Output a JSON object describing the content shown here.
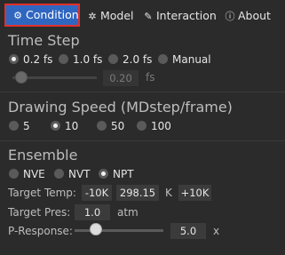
{
  "tabs": [
    {
      "label": "Condition",
      "icon": "gear-icon"
    },
    {
      "label": "Model",
      "icon": "atom-icon"
    },
    {
      "label": "Interaction",
      "icon": "wand-icon"
    },
    {
      "label": "About",
      "icon": "info-icon"
    }
  ],
  "time_step": {
    "heading": "Time Step",
    "options": [
      "0.2 fs",
      "1.0 fs",
      "2.0 fs",
      "Manual"
    ],
    "selected": "0.2 fs",
    "manual_value": "0.20",
    "manual_unit": "fs"
  },
  "drawing_speed": {
    "heading": "Drawing Speed (MDstep/frame)",
    "options": [
      "5",
      "10",
      "50",
      "100"
    ],
    "selected": "10"
  },
  "ensemble": {
    "heading": "Ensemble",
    "options": [
      "NVE",
      "NVT",
      "NPT"
    ],
    "selected": "NPT",
    "target_temp_label": "Target Temp:",
    "temp_minus": "-10K",
    "temp_value": "298.15",
    "temp_unit": "K",
    "temp_plus": "+10K",
    "target_pres_label": "Target Pres:",
    "pres_value": "1.0",
    "pres_unit": "atm",
    "p_response_label": "P-Response:",
    "p_response_value": "5.0",
    "p_response_unit": "x"
  },
  "colors": {
    "accent": "#2f66c0",
    "highlight_border": "#e0302b",
    "background": "#2b2b2b"
  }
}
